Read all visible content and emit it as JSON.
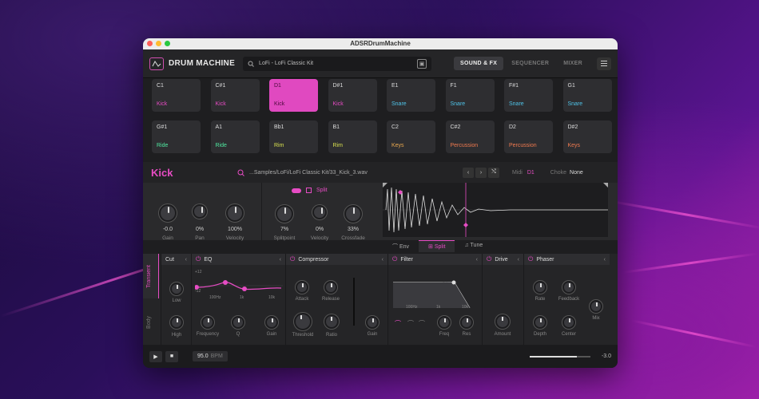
{
  "window": {
    "title": "ADSRDrumMachine"
  },
  "header": {
    "brand": "DRUM MACHINE",
    "search_value": "LoFi - LoFi Classic Kit",
    "tabs": [
      {
        "label": "SOUND & FX",
        "active": true
      },
      {
        "label": "SEQUENCER",
        "active": false
      },
      {
        "label": "MIXER",
        "active": false
      }
    ]
  },
  "pads": [
    {
      "note": "C1",
      "name": "Kick",
      "color": "#e74cc4"
    },
    {
      "note": "C#1",
      "name": "Kick",
      "color": "#e74cc4"
    },
    {
      "note": "D1",
      "name": "Kick",
      "color": "#4a0a3a",
      "active": true
    },
    {
      "note": "D#1",
      "name": "Kick",
      "color": "#e74cc4"
    },
    {
      "note": "E1",
      "name": "Snare",
      "color": "#4fc3e8"
    },
    {
      "note": "F1",
      "name": "Snare",
      "color": "#4fc3e8"
    },
    {
      "note": "F#1",
      "name": "Snare",
      "color": "#4fc3e8"
    },
    {
      "note": "G1",
      "name": "Snare",
      "color": "#4fc3e8"
    },
    {
      "note": "G#1",
      "name": "Ride",
      "color": "#4fe8a0"
    },
    {
      "note": "A1",
      "name": "Ride",
      "color": "#4fe8a0"
    },
    {
      "note": "Bb1",
      "name": "Rim",
      "color": "#d8e04f"
    },
    {
      "note": "B1",
      "name": "Rim",
      "color": "#d8e04f"
    },
    {
      "note": "C2",
      "name": "Keys",
      "color": "#e8a84f"
    },
    {
      "note": "C#2",
      "name": "Percussion",
      "color": "#f07a4f"
    },
    {
      "note": "D2",
      "name": "Percussion",
      "color": "#f07a4f"
    },
    {
      "note": "D#2",
      "name": "Keys",
      "color": "#f07a4f"
    }
  ],
  "detail": {
    "title": "Kick",
    "path": "...Samples/LoFi/LoFi Classic Kit/33_Kick_3.wav",
    "midi_label": "Midi",
    "midi_value": "D1",
    "choke_label": "Choke",
    "choke_value": "None"
  },
  "mix": {
    "split_label": "Split",
    "knobs": [
      {
        "value": "-0.0",
        "label": "Gain"
      },
      {
        "value": "0%",
        "label": "Pan"
      },
      {
        "value": "100%",
        "label": "Velocity"
      },
      {
        "value": "7%",
        "label": "Splitpoint"
      },
      {
        "value": "0%",
        "label": "Velocity"
      },
      {
        "value": "33%",
        "label": "Crossfade"
      }
    ],
    "env_tabs": [
      "Env",
      "Split",
      "Tune"
    ]
  },
  "fx": {
    "side_tabs": [
      "Transient",
      "Body"
    ],
    "modules": [
      {
        "title": "Cut",
        "labels": [
          "Low",
          "High"
        ]
      },
      {
        "title": "EQ",
        "labels": [
          "Frequency",
          "Q",
          "Gain"
        ],
        "axis": [
          "+12",
          "-12",
          "100Hz",
          "1k",
          "10k"
        ]
      },
      {
        "title": "Compressor",
        "labels": [
          "Attack",
          "Release",
          "Threshold",
          "Ratio",
          "Gain"
        ]
      },
      {
        "title": "Filter",
        "labels": [
          "Freq",
          "Res"
        ],
        "axis": [
          "100Hz",
          "1k",
          "10k"
        ]
      },
      {
        "title": "Drive",
        "labels": [
          "Amount"
        ]
      },
      {
        "title": "Phaser",
        "labels": [
          "Rate",
          "Feedback",
          "Mix",
          "Depth",
          "Center"
        ]
      }
    ]
  },
  "transport": {
    "bpm": "95.0",
    "bpm_label": "BPM",
    "volume": "-3.0",
    "volume_level": 0.78
  }
}
